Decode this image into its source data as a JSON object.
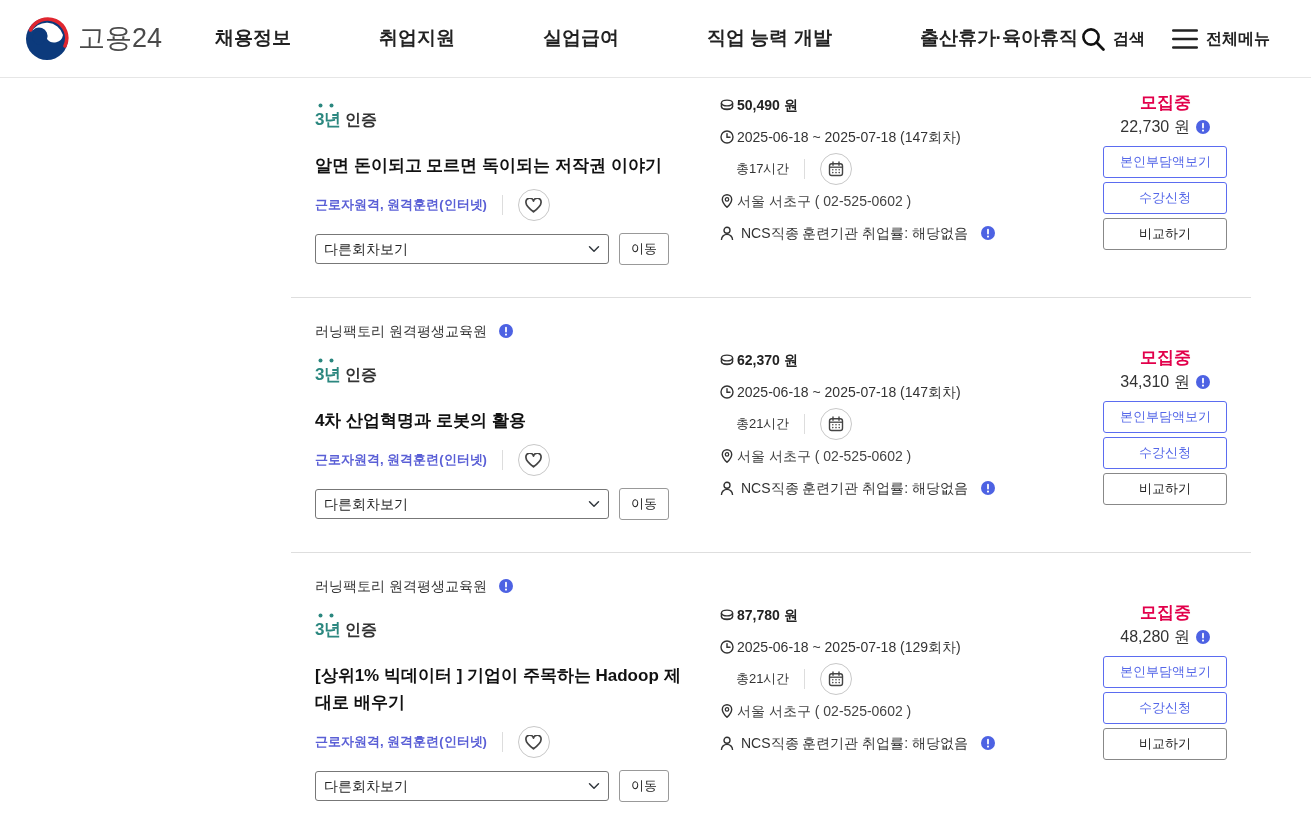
{
  "header": {
    "logo_text": "고용24",
    "nav": [
      "채용정보",
      "취업지원",
      "실업급여",
      "직업 능력 개발",
      "출산휴가·육아휴직"
    ],
    "search_label": "검색",
    "menu_label": "전체메뉴"
  },
  "courses": [
    {
      "certification": {
        "years": "3년",
        "label": "인증"
      },
      "title": "알면 돈이되고 모르면 독이되는 저작권 이야기",
      "tags": "근로자원격, 원격훈련(인터넷)",
      "session_select": "다른회차보기",
      "go_button": "이동",
      "price": "50,490 원",
      "period": "2025-06-18 ~ 2025-07-18 (147회차)",
      "hours": "총17시간",
      "location": "서울 서초구 ( 02-525-0602 )",
      "employment_rate": "NCS직종 훈련기관 취업률: 해당없음",
      "status": "모집중",
      "self_pay": "22,730 원",
      "buttons": [
        {
          "label": "본인부담액보기",
          "kind": "accent"
        },
        {
          "label": "수강신청",
          "kind": "accent"
        },
        {
          "label": "비교하기",
          "kind": "plain"
        }
      ]
    },
    {
      "institution": "러닝팩토리 원격평생교육원",
      "certification": {
        "years": "3년",
        "label": "인증"
      },
      "title": "4차 산업혁명과 로봇의 활용",
      "tags": "근로자원격, 원격훈련(인터넷)",
      "session_select": "다른회차보기",
      "go_button": "이동",
      "price": "62,370 원",
      "period": "2025-06-18 ~ 2025-07-18 (147회차)",
      "hours": "총21시간",
      "location": "서울 서초구 ( 02-525-0602 )",
      "employment_rate": "NCS직종 훈련기관 취업률: 해당없음",
      "status": "모집중",
      "self_pay": "34,310 원",
      "buttons": [
        {
          "label": "본인부담액보기",
          "kind": "accent"
        },
        {
          "label": "수강신청",
          "kind": "accent"
        },
        {
          "label": "비교하기",
          "kind": "plain"
        }
      ]
    },
    {
      "institution": "러닝팩토리 원격평생교육원",
      "certification": {
        "years": "3년",
        "label": "인증"
      },
      "title": "[상위1% 빅데이터 ] 기업이 주목하는 Hadoop 제대로 배우기",
      "tags": "근로자원격, 원격훈련(인터넷)",
      "session_select": "다른회차보기",
      "go_button": "이동",
      "price": "87,780 원",
      "period": "2025-06-18 ~ 2025-07-18 (129회차)",
      "hours": "총21시간",
      "location": "서울 서초구 ( 02-525-0602 )",
      "employment_rate": "NCS직종 훈련기관 취업률: 해당없음",
      "status": "모집중",
      "self_pay": "48,280 원",
      "buttons": [
        {
          "label": "본인부담액보기",
          "kind": "accent"
        },
        {
          "label": "수강신청",
          "kind": "accent"
        },
        {
          "label": "비교하기",
          "kind": "plain"
        }
      ]
    }
  ]
}
